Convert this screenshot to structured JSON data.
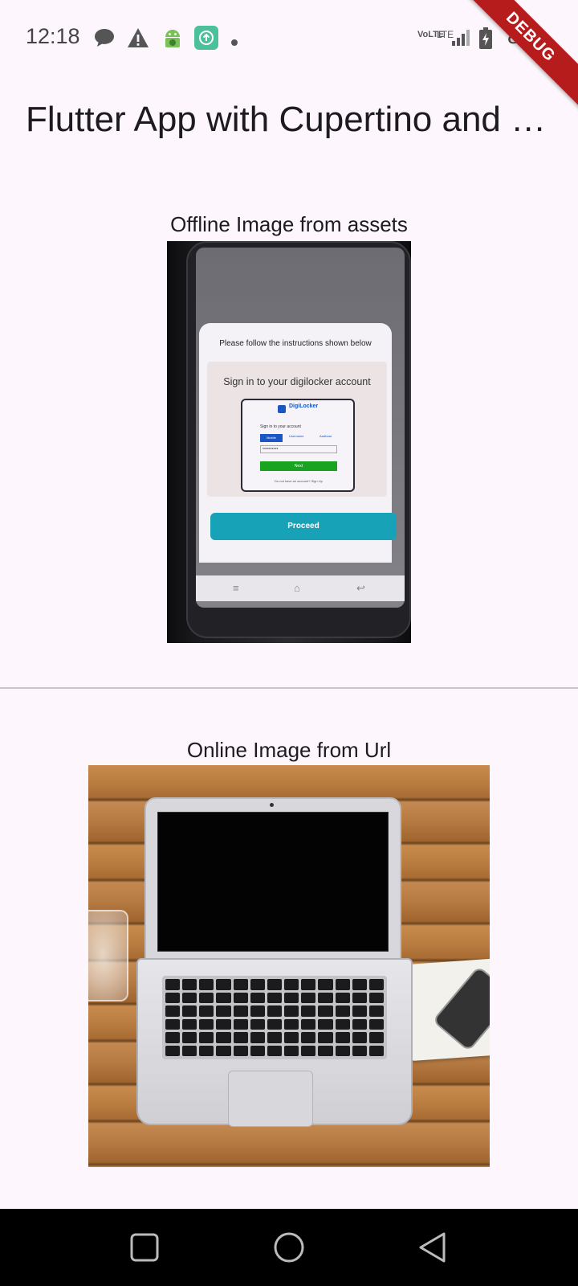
{
  "status_bar": {
    "time": "12:18",
    "left_icons": [
      "chat-bubble-icon",
      "warning-icon",
      "android-icon",
      "upload-app-icon",
      "dot-icon"
    ],
    "network_label": "VoLTE",
    "lte_label": "LTE",
    "battery": "88"
  },
  "debug_banner": "DEBUG",
  "app_bar": {
    "title": "Flutter App with Cupertino and Material Design"
  },
  "offline_section": {
    "caption": "Offline Image from assets",
    "photo": {
      "modal_title": "Please follow the instructions shown below",
      "card_title": "Sign in to your digilocker account",
      "brand": "DigiLocker",
      "signin_label": "Sign in to your account",
      "tab_mobile": "Mobile",
      "tab_username": "Username",
      "tab_aadhaar": "Aadhaar",
      "masked_input": "**********",
      "next_label": "Next",
      "footer_text": "Do not have an account? Sign Up",
      "proceed_label": "Proceed"
    }
  },
  "online_section": {
    "caption": "Online Image from Url"
  },
  "system_nav": {
    "items": [
      "recents-square-icon",
      "home-circle-icon",
      "back-triangle-icon"
    ]
  }
}
